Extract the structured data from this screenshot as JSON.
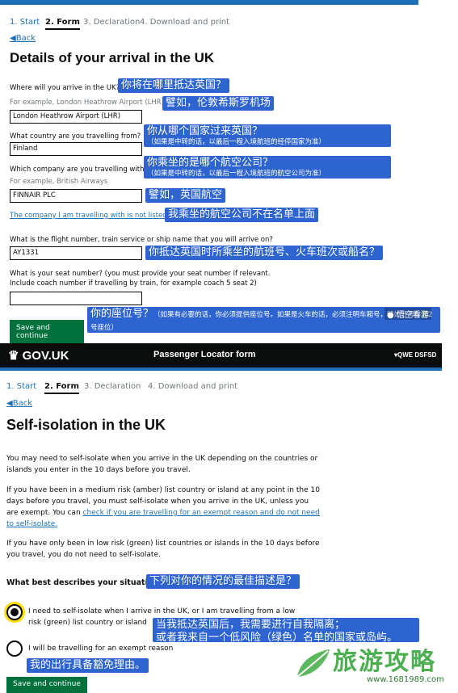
{
  "top": {
    "steps": [
      "1. Start",
      "2. Form",
      "3. Declaration",
      "4. Download and print"
    ],
    "back": "Back",
    "title": "Details of your arrival in the UK",
    "arrive": {
      "label": "Where will you arrive in the UK?",
      "hint": "For example, London Heathrow Airport (LHR)",
      "value": "London Heathrow Airport (LHR)",
      "ann_label": "你将在哪里抵达英国？",
      "ann_hint": "譬如，伦敦希斯罗机场"
    },
    "country": {
      "label": "What country are you travelling from?",
      "value": "Finland",
      "ann": "你从哪个国家过来英国？",
      "ann_note": "（如果是中转的话，以最后一程入境航班的经停国家为准）"
    },
    "company": {
      "label": "Which company are you travelling with?",
      "hint": "For example, British Airways",
      "value": "FINNAIR PLC",
      "ann": "你乘坐的是哪个航空公司？",
      "ann_note": "（如果是中转的话，以最后一程入境航班的航空公司为准）",
      "ann_value": "譬如，英国航空"
    },
    "not_listed": {
      "link": "The company I am travelling with is not listed",
      "ann": "我乘坐的航空公司不在名单上面"
    },
    "flight": {
      "label": "What is the flight number, train service or ship name that you will arrive on?",
      "value": "AY1331",
      "ann": "你抵达英国时所乘坐的航班号、火车班次或船名？"
    },
    "seat": {
      "label": "What is your seat number? (you must provide your seat number if relevant. Include coach number if travelling by train, for example coach 5 seat 2)",
      "value": "",
      "ann": "你的座位号？",
      "ann_note": "（如果有必要的话，你必须提供座位号。如果是火车的话，必须注明车厢号，譬如五号车厢2号座位）"
    },
    "button": "Save and continue",
    "watermark": "悟空看游"
  },
  "bottom": {
    "brand": "GOV.UK",
    "service": "Passenger Locator form",
    "ref": "QWE DSFSD",
    "steps": [
      "1. Start",
      "2. Form",
      "3. Declaration",
      "4. Download and print"
    ],
    "back": "Back",
    "title": "Self-isolation in the UK",
    "p1": "You may need to self-isolate when you arrive in the UK depending on the countries or islands you enter in the 10 days before you travel.",
    "p2a": "If you have been in a medium risk (amber) list country or island at any point in the 10 days before you travel, you must self-isolate when you arrive in the UK, unless you are exempt. You can ",
    "p2link": "check if you are travelling for an exempt reason and do not need to self-isolate.",
    "p3": "If you have only been in low risk (green) list countries or islands in the 10 days before you travel, you do not need to self-isolate.",
    "question": "What best describes your situation?",
    "question_ann": "下列对你的情况的最佳描述是？",
    "opt1": "I need to self-isolate when I arrive in the UK, or I am travelling from a low risk (green) list country or island",
    "opt1_ann1": "当我抵达英国后，我需要进行自我隔离；",
    "opt1_ann2": "或者我来自一个低风险（绿色）名单的国家或岛屿。",
    "opt2": "I will be travelling for an exempt reason",
    "opt2_ann": "我的出行具备豁免理由。",
    "button": "Save and continue",
    "logo_text": "旅游攻略",
    "logo_url": "www.1681989.com"
  }
}
